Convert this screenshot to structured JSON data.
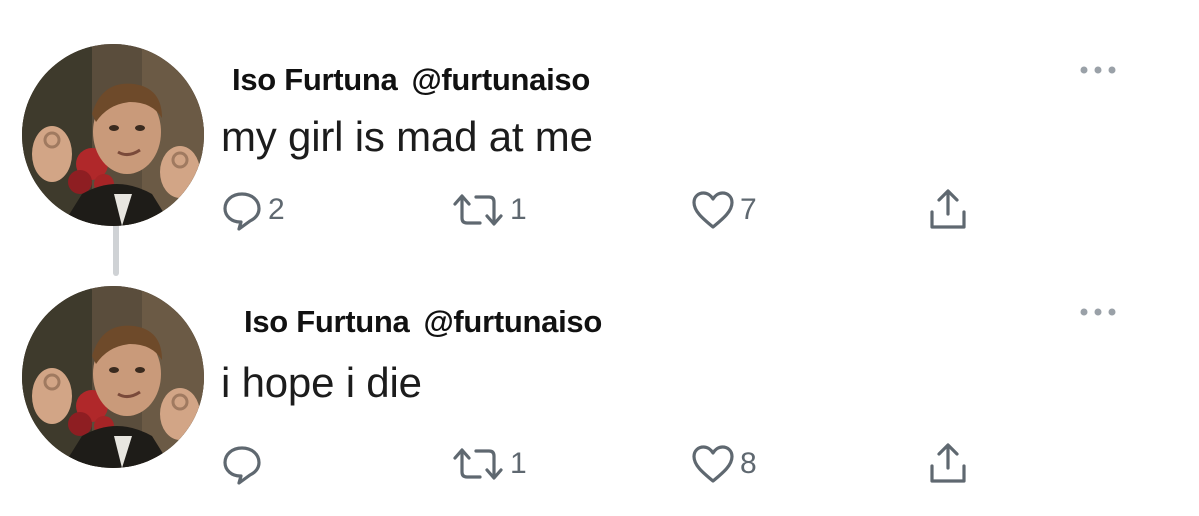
{
  "tweets": [
    {
      "author_name": "Iso Furtuna",
      "handle": "@furtunaiso",
      "text": "my girl is mad at me",
      "reply_count": "2",
      "retweet_count": "1",
      "like_count": "7"
    },
    {
      "author_name": "Iso Furtuna",
      "handle": "@furtunaiso",
      "text": "i hope i die",
      "reply_count": "",
      "retweet_count": "1",
      "like_count": "8"
    }
  ],
  "icons": {
    "reply": "speech-bubble-icon",
    "retweet": "retweet-arrows-icon",
    "like": "heart-icon",
    "share": "share-upload-icon",
    "more": "more-dots-icon"
  },
  "colors": {
    "icon_gray": "#5f6870",
    "thread_line": "#cfd2d5",
    "text": "#1c1c1c"
  }
}
